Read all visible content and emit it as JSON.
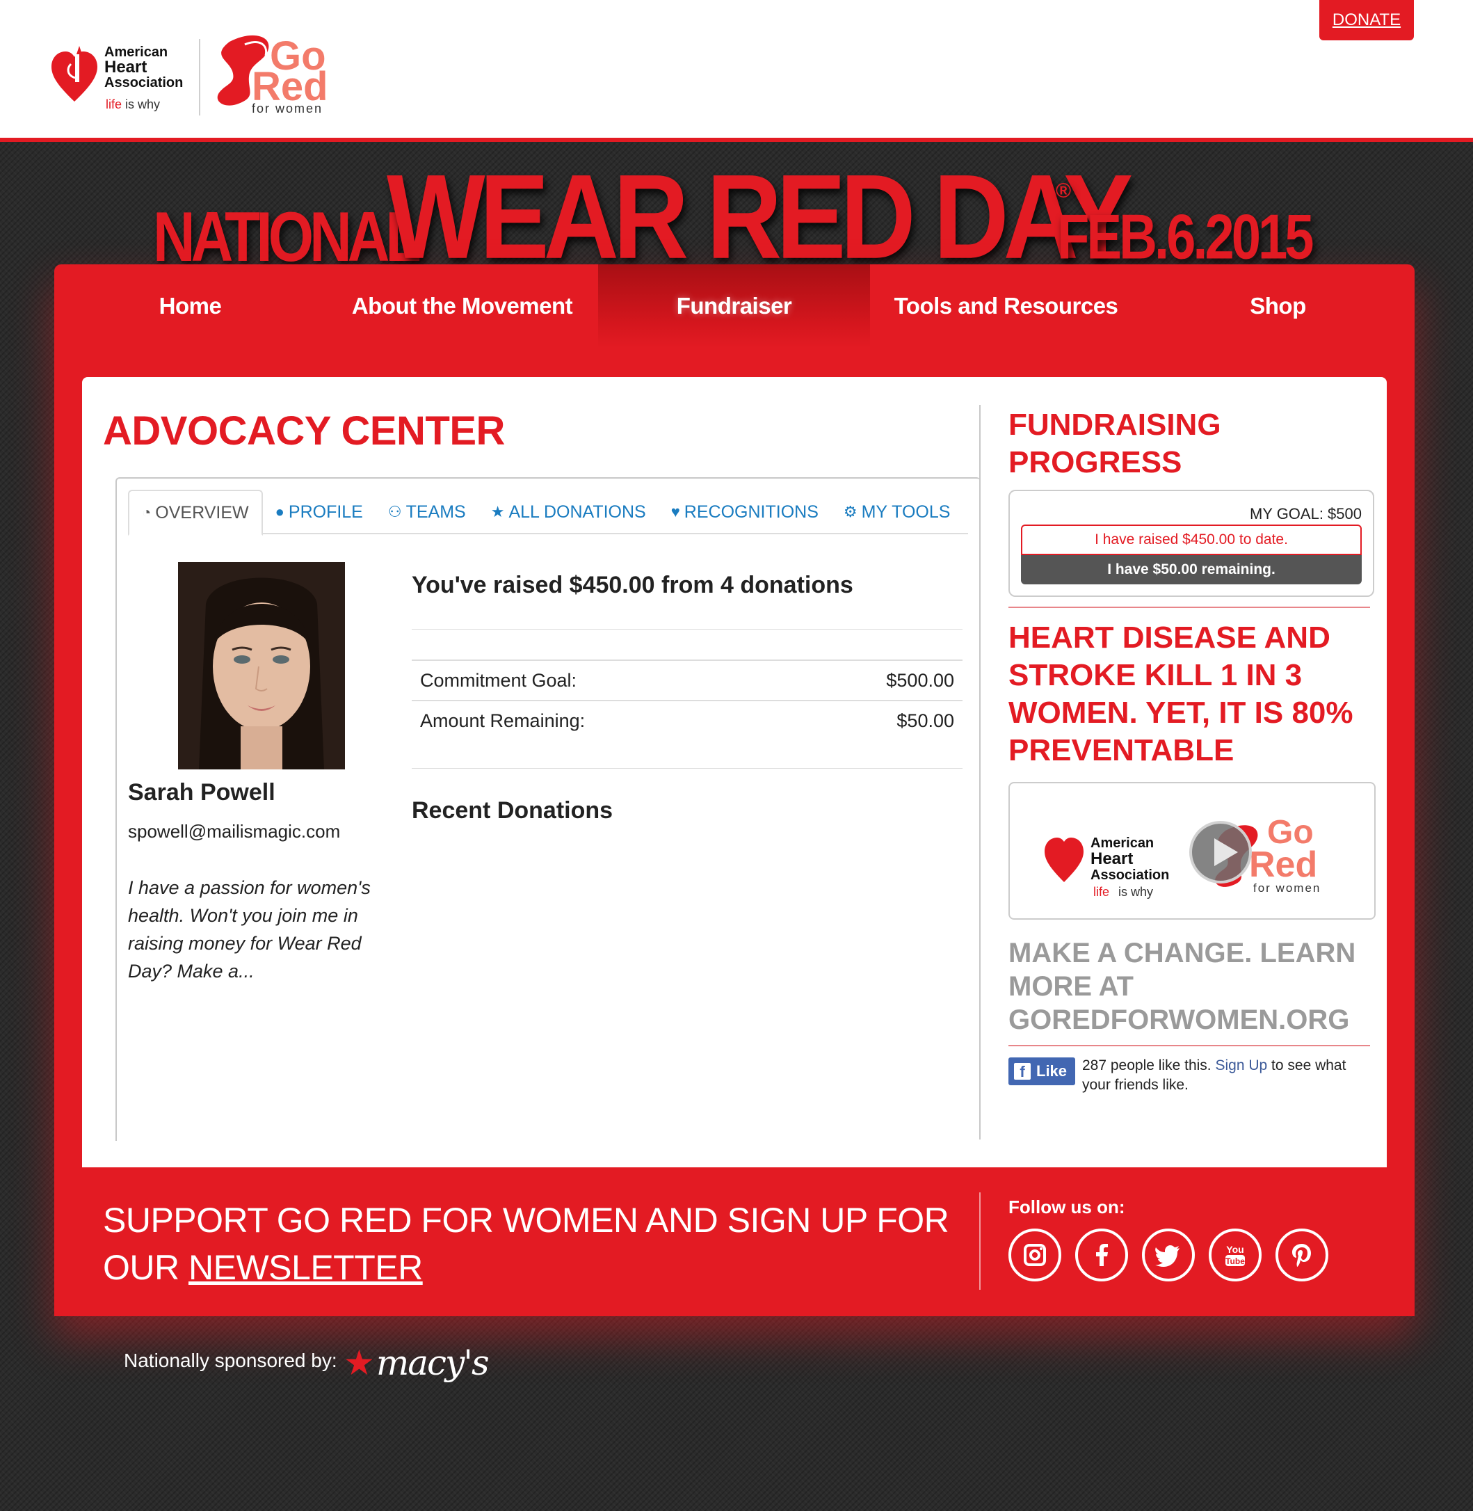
{
  "header": {
    "aha_logo": {
      "line1": "American",
      "line2": "Heart",
      "line3": "Association",
      "tag_red": "life",
      "tag_rest": "is why"
    },
    "gored_logo": {
      "go": "Go",
      "red": "Red",
      "sub": "for women"
    },
    "donate_label": "DONATE"
  },
  "banner": {
    "national": "NATIONAL",
    "wear_red_day": "WEAR RED DAY",
    "reg": "®",
    "date": "FEB.6.2015"
  },
  "nav": {
    "items": [
      {
        "label": "Home"
      },
      {
        "label": "About the Movement"
      },
      {
        "label": "Fundraiser"
      },
      {
        "label": "Tools and Resources"
      },
      {
        "label": "Shop"
      }
    ],
    "active": "Fundraiser"
  },
  "advocacy": {
    "title": "ADVOCACY CENTER",
    "tabs": [
      {
        "label": "OVERVIEW",
        "icon": "dashboard-icon"
      },
      {
        "label": "PROFILE",
        "icon": "user-icon"
      },
      {
        "label": "TEAMS",
        "icon": "users-icon"
      },
      {
        "label": "ALL DONATIONS",
        "icon": "star-icon"
      },
      {
        "label": "RECOGNITIONS",
        "icon": "heart-icon"
      },
      {
        "label": "MY TOOLS",
        "icon": "cogs-icon"
      }
    ],
    "user": {
      "name": "Sarah Powell",
      "email": "spowell@mailismagic.com",
      "bio": "I have a passion for women's health. Won't you join me in raising money for Wear Red Day? Make a..."
    },
    "raised_heading": "You've raised $450.00 from 4 donations",
    "stats": [
      {
        "label": "Commitment Goal:",
        "value": "$500.00"
      },
      {
        "label": "Amount Remaining:",
        "value": "$50.00"
      }
    ],
    "recent_heading": "Recent Donations"
  },
  "sidebar": {
    "progress_title": "FUNDRAISING PROGRESS",
    "goal_label": "MY GOAL: $500",
    "raised_text": "I have raised $450.00 to date.",
    "remaining_text": "I have $50.00 remaining.",
    "progress_fraction": 0.9,
    "stat_title": "HEART DISEASE AND STROKE KILL 1 IN 3 WOMEN. YET, IT IS 80% PREVENTABLE",
    "change_text": "MAKE A CHANGE. LEARN MORE AT GOREDFORWOMEN.ORG",
    "facebook": {
      "like_label": "Like",
      "count_text": "287 people like this.",
      "signup_label": "Sign Up",
      "after_text": "to see what your friends like."
    }
  },
  "footer": {
    "newsletter_text": "SUPPORT GO RED FOR WOMEN AND SIGN UP FOR OUR",
    "newsletter_link": "NEWSLETTER",
    "follow_label": "Follow us on:",
    "social": [
      "instagram-icon",
      "facebook-icon",
      "twitter-icon",
      "youtube-icon",
      "pinterest-icon"
    ],
    "sponsor_label": "Nationally sponsored by:",
    "sponsor_name": "macy's"
  },
  "colors": {
    "brand_red": "#e31b23",
    "link_blue": "#1a7cc0",
    "facebook_blue": "#4267b2"
  }
}
